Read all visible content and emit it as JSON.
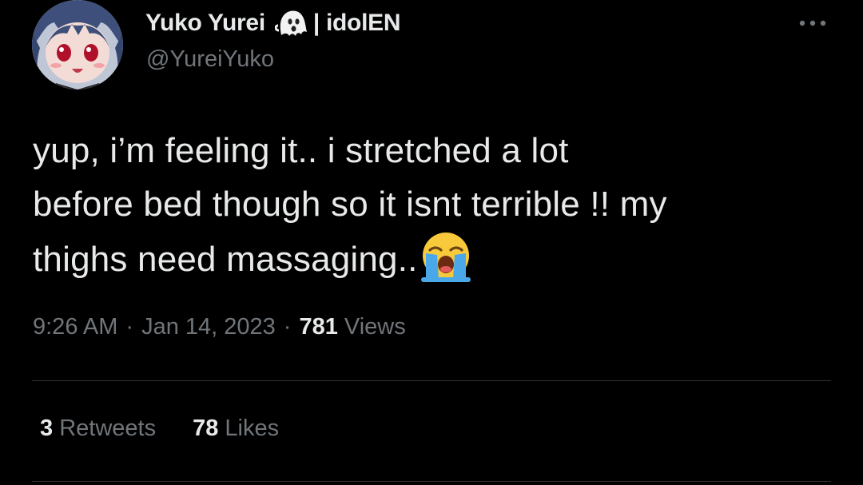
{
  "author": {
    "display_name": "Yuko Yurei",
    "name_suffix": "| idolEN",
    "handle": "@YureiYuko",
    "name_icon": "ghost-emoji"
  },
  "header": {
    "more_icon": "ellipsis-icon"
  },
  "tweet": {
    "text_lines": [
      "yup, i’m feeling it.. i stretched a lot",
      "before bed though so it isnt terrible !! my",
      "thighs need massaging.."
    ],
    "trailing_emoji": "loudly-crying-face-emoji"
  },
  "meta": {
    "time": "9:26 AM",
    "separator": "·",
    "date": "Jan 14, 2023",
    "views_count": "781",
    "views_label": "Views"
  },
  "stats": {
    "retweets_count": "3",
    "retweets_label": "Retweets",
    "likes_count": "78",
    "likes_label": "Likes"
  },
  "colors": {
    "background": "#000000",
    "primary_text": "#e7e9ea",
    "secondary_text": "#71767b",
    "divider": "#2f3336"
  }
}
